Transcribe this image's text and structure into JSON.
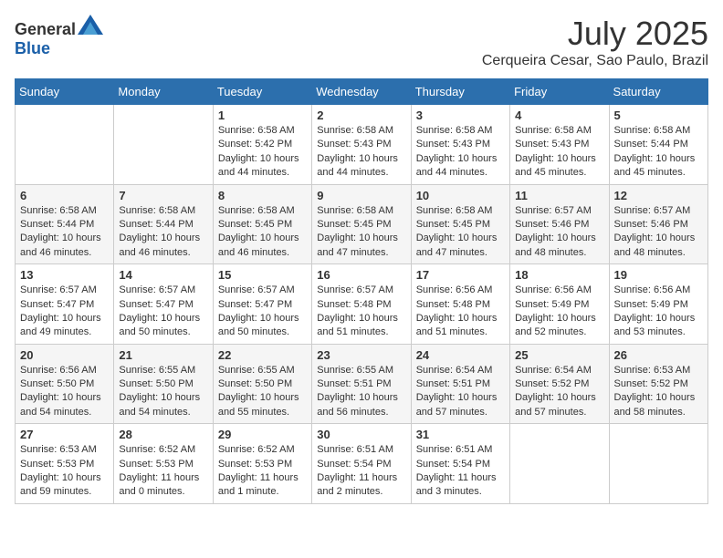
{
  "header": {
    "logo_general": "General",
    "logo_blue": "Blue",
    "month": "July 2025",
    "location": "Cerqueira Cesar, Sao Paulo, Brazil"
  },
  "days_of_week": [
    "Sunday",
    "Monday",
    "Tuesday",
    "Wednesday",
    "Thursday",
    "Friday",
    "Saturday"
  ],
  "weeks": [
    [
      {
        "day": "",
        "info": ""
      },
      {
        "day": "",
        "info": ""
      },
      {
        "day": "1",
        "sunrise": "6:58 AM",
        "sunset": "5:42 PM",
        "daylight": "10 hours and 44 minutes."
      },
      {
        "day": "2",
        "sunrise": "6:58 AM",
        "sunset": "5:43 PM",
        "daylight": "10 hours and 44 minutes."
      },
      {
        "day": "3",
        "sunrise": "6:58 AM",
        "sunset": "5:43 PM",
        "daylight": "10 hours and 44 minutes."
      },
      {
        "day": "4",
        "sunrise": "6:58 AM",
        "sunset": "5:43 PM",
        "daylight": "10 hours and 45 minutes."
      },
      {
        "day": "5",
        "sunrise": "6:58 AM",
        "sunset": "5:44 PM",
        "daylight": "10 hours and 45 minutes."
      }
    ],
    [
      {
        "day": "6",
        "sunrise": "6:58 AM",
        "sunset": "5:44 PM",
        "daylight": "10 hours and 46 minutes."
      },
      {
        "day": "7",
        "sunrise": "6:58 AM",
        "sunset": "5:44 PM",
        "daylight": "10 hours and 46 minutes."
      },
      {
        "day": "8",
        "sunrise": "6:58 AM",
        "sunset": "5:45 PM",
        "daylight": "10 hours and 46 minutes."
      },
      {
        "day": "9",
        "sunrise": "6:58 AM",
        "sunset": "5:45 PM",
        "daylight": "10 hours and 47 minutes."
      },
      {
        "day": "10",
        "sunrise": "6:58 AM",
        "sunset": "5:45 PM",
        "daylight": "10 hours and 47 minutes."
      },
      {
        "day": "11",
        "sunrise": "6:57 AM",
        "sunset": "5:46 PM",
        "daylight": "10 hours and 48 minutes."
      },
      {
        "day": "12",
        "sunrise": "6:57 AM",
        "sunset": "5:46 PM",
        "daylight": "10 hours and 48 minutes."
      }
    ],
    [
      {
        "day": "13",
        "sunrise": "6:57 AM",
        "sunset": "5:47 PM",
        "daylight": "10 hours and 49 minutes."
      },
      {
        "day": "14",
        "sunrise": "6:57 AM",
        "sunset": "5:47 PM",
        "daylight": "10 hours and 50 minutes."
      },
      {
        "day": "15",
        "sunrise": "6:57 AM",
        "sunset": "5:47 PM",
        "daylight": "10 hours and 50 minutes."
      },
      {
        "day": "16",
        "sunrise": "6:57 AM",
        "sunset": "5:48 PM",
        "daylight": "10 hours and 51 minutes."
      },
      {
        "day": "17",
        "sunrise": "6:56 AM",
        "sunset": "5:48 PM",
        "daylight": "10 hours and 51 minutes."
      },
      {
        "day": "18",
        "sunrise": "6:56 AM",
        "sunset": "5:49 PM",
        "daylight": "10 hours and 52 minutes."
      },
      {
        "day": "19",
        "sunrise": "6:56 AM",
        "sunset": "5:49 PM",
        "daylight": "10 hours and 53 minutes."
      }
    ],
    [
      {
        "day": "20",
        "sunrise": "6:56 AM",
        "sunset": "5:50 PM",
        "daylight": "10 hours and 54 minutes."
      },
      {
        "day": "21",
        "sunrise": "6:55 AM",
        "sunset": "5:50 PM",
        "daylight": "10 hours and 54 minutes."
      },
      {
        "day": "22",
        "sunrise": "6:55 AM",
        "sunset": "5:50 PM",
        "daylight": "10 hours and 55 minutes."
      },
      {
        "day": "23",
        "sunrise": "6:55 AM",
        "sunset": "5:51 PM",
        "daylight": "10 hours and 56 minutes."
      },
      {
        "day": "24",
        "sunrise": "6:54 AM",
        "sunset": "5:51 PM",
        "daylight": "10 hours and 57 minutes."
      },
      {
        "day": "25",
        "sunrise": "6:54 AM",
        "sunset": "5:52 PM",
        "daylight": "10 hours and 57 minutes."
      },
      {
        "day": "26",
        "sunrise": "6:53 AM",
        "sunset": "5:52 PM",
        "daylight": "10 hours and 58 minutes."
      }
    ],
    [
      {
        "day": "27",
        "sunrise": "6:53 AM",
        "sunset": "5:53 PM",
        "daylight": "10 hours and 59 minutes."
      },
      {
        "day": "28",
        "sunrise": "6:52 AM",
        "sunset": "5:53 PM",
        "daylight": "11 hours and 0 minutes."
      },
      {
        "day": "29",
        "sunrise": "6:52 AM",
        "sunset": "5:53 PM",
        "daylight": "11 hours and 1 minute."
      },
      {
        "day": "30",
        "sunrise": "6:51 AM",
        "sunset": "5:54 PM",
        "daylight": "11 hours and 2 minutes."
      },
      {
        "day": "31",
        "sunrise": "6:51 AM",
        "sunset": "5:54 PM",
        "daylight": "11 hours and 3 minutes."
      },
      {
        "day": "",
        "info": ""
      },
      {
        "day": "",
        "info": ""
      }
    ]
  ]
}
